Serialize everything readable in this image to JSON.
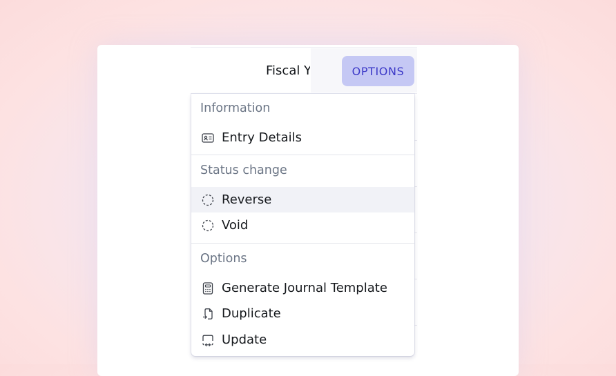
{
  "header": {
    "fiscal_column": "Fiscal Year",
    "options_button": "OPTIONS"
  },
  "menu": {
    "sections": [
      {
        "title": "Information",
        "items": [
          {
            "label": "Entry Details",
            "icon": "id-card-icon"
          }
        ]
      },
      {
        "title": "Status change",
        "items": [
          {
            "label": "Reverse",
            "icon": "dashed-circle-icon",
            "highlighted": true
          },
          {
            "label": "Void",
            "icon": "dashed-circle-icon"
          }
        ]
      },
      {
        "title": "Options",
        "items": [
          {
            "label": "Generate Journal Template",
            "icon": "calculator-icon"
          },
          {
            "label": "Duplicate",
            "icon": "duplicate-file-icon"
          },
          {
            "label": "Update",
            "icon": "update-window-icon"
          }
        ]
      }
    ]
  },
  "colors": {
    "accent_bg": "#c5c8f4",
    "accent_text": "#3b38c7",
    "hover_bg": "#f1f2f7",
    "section_label": "#6b7585"
  }
}
